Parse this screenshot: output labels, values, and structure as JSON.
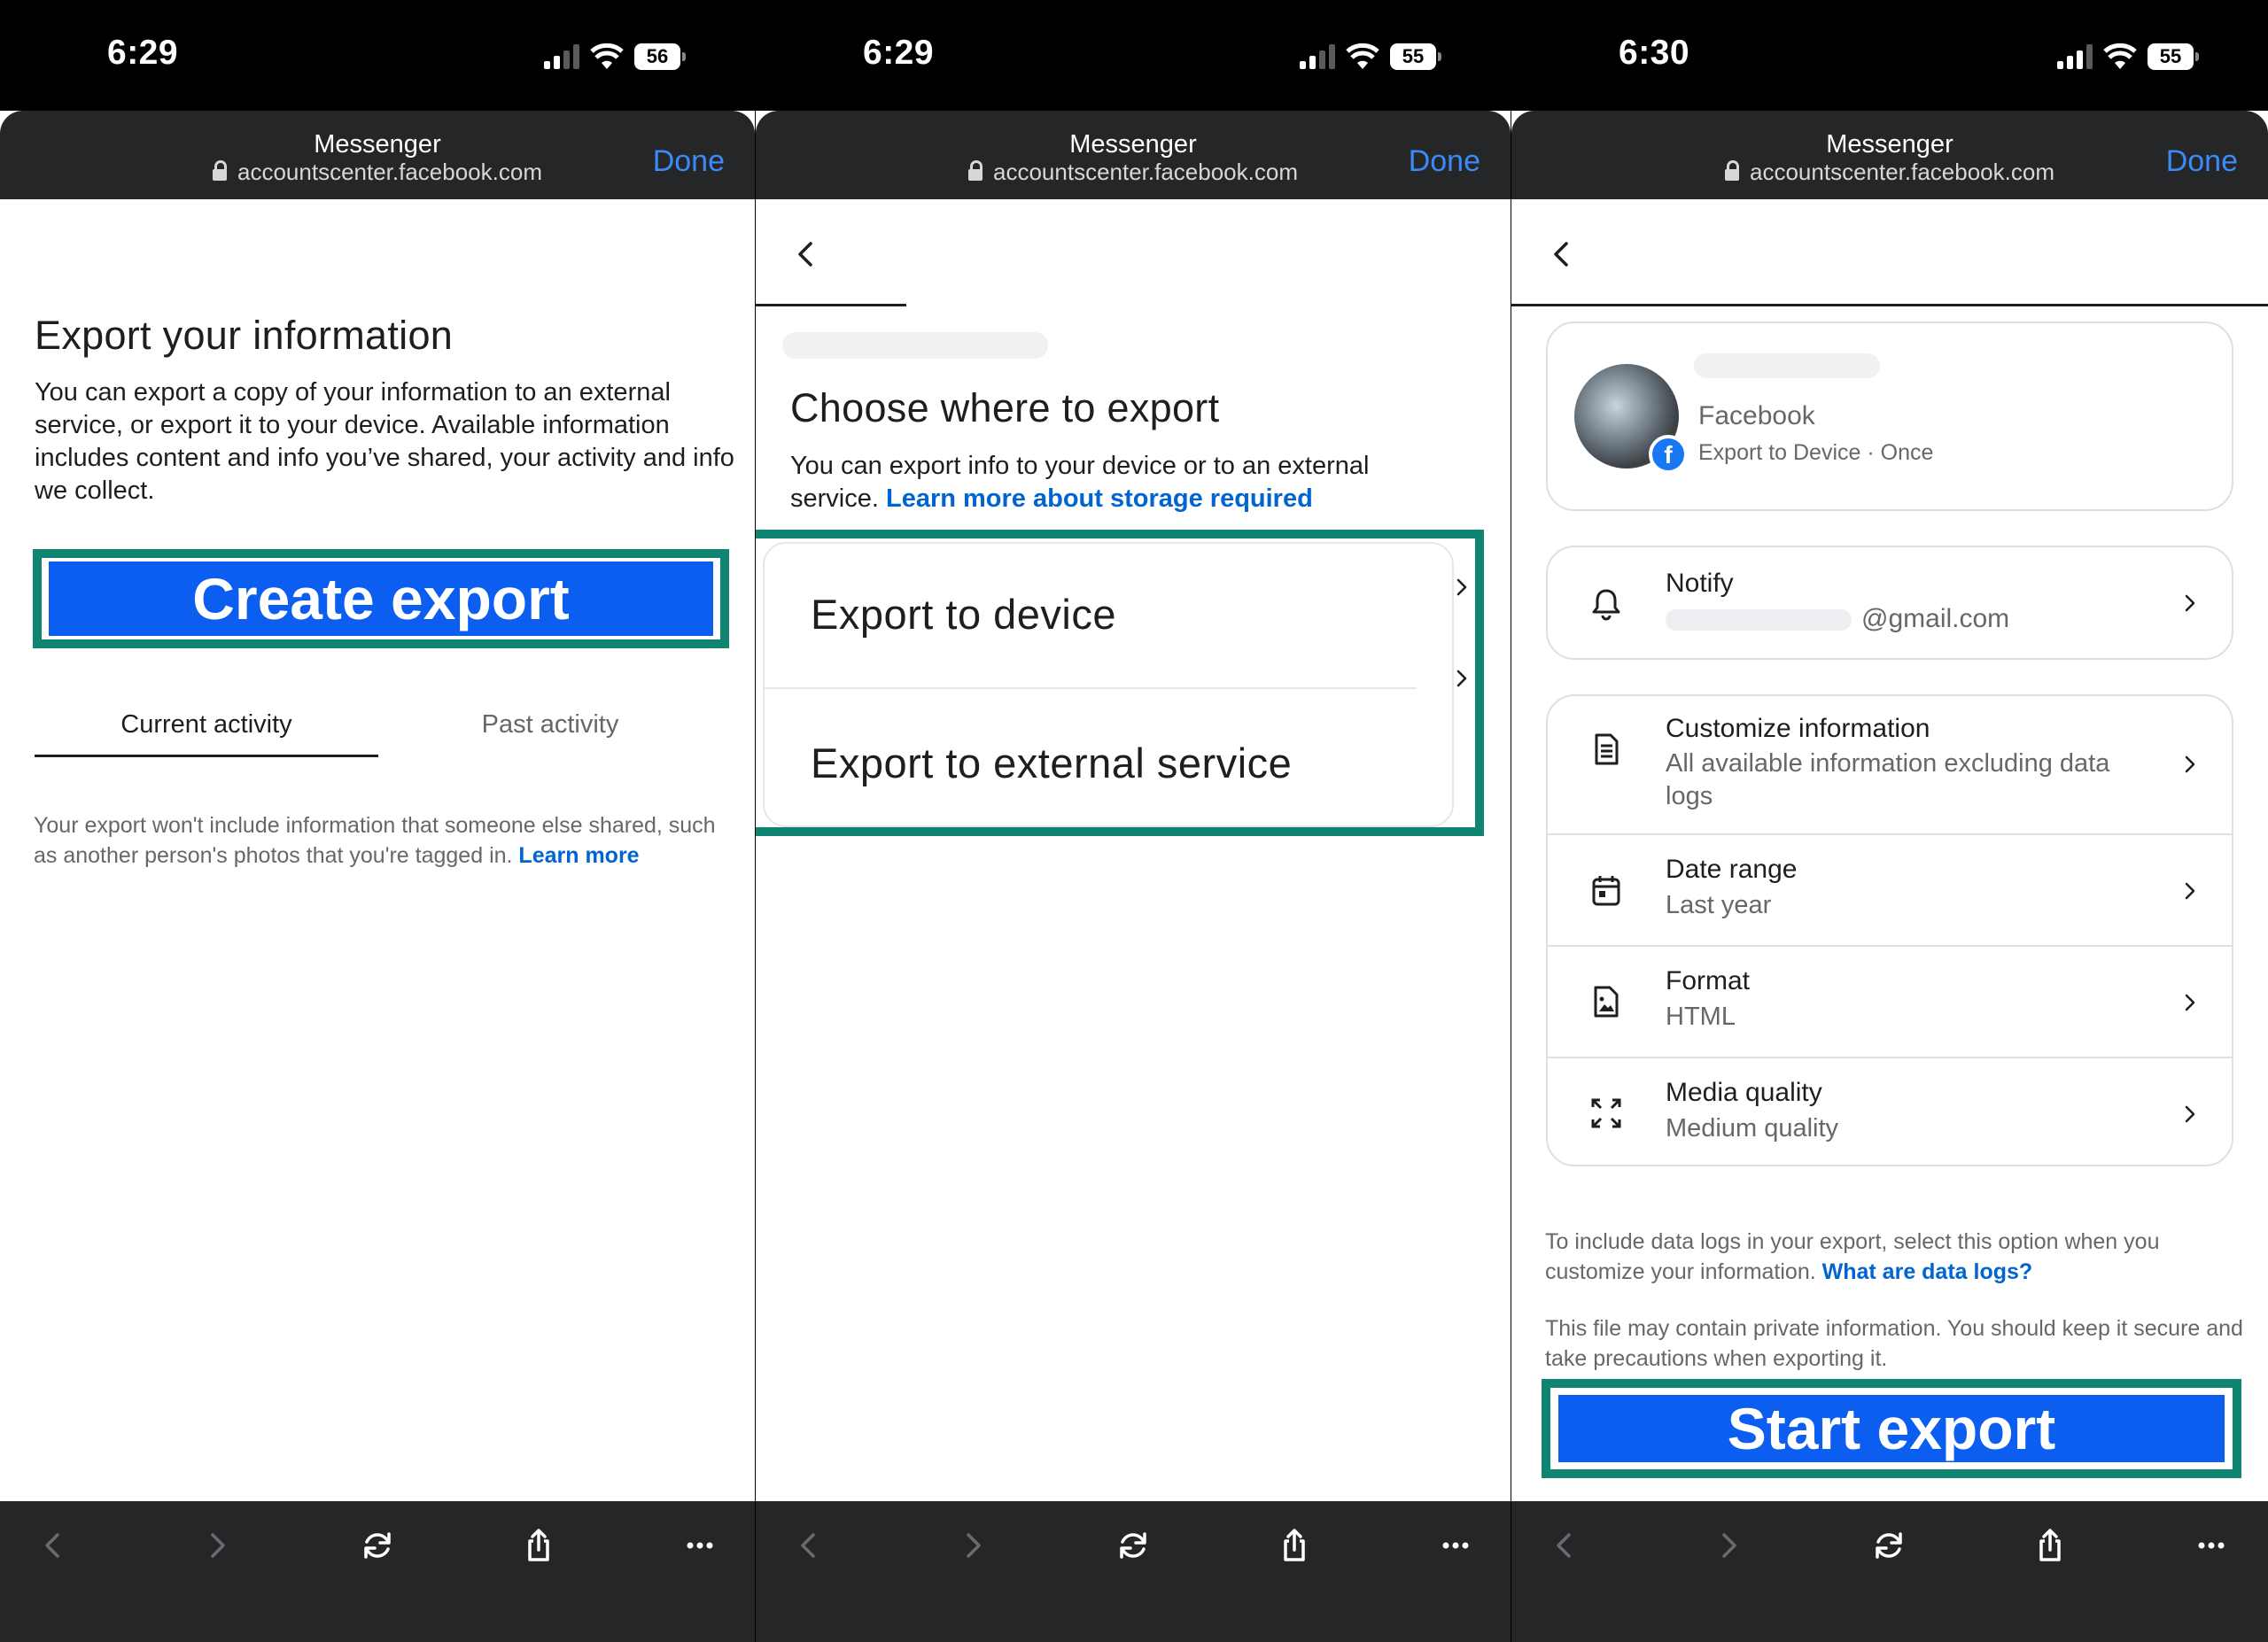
{
  "colors": {
    "highlight": "#0f8470",
    "primary_button": "#0b5ef0",
    "link": "#0064d1",
    "done": "#3b8af7"
  },
  "screens": [
    {
      "status": {
        "time": "6:29",
        "battery": "56"
      },
      "browser": {
        "title": "Messenger",
        "host": "accountscenter.facebook.com",
        "done": "Done"
      },
      "heading": "Export your information",
      "description": "You can export a copy of your information to an external service, or export it to your device. Available information includes content and info you’ve shared, your activity and info we collect.",
      "create_export": "Create export",
      "tabs": [
        "Current activity",
        "Past activity"
      ],
      "note": "Your export won't include information that someone else shared, such as another person's photos that you're tagged in.",
      "note_link": "Learn more"
    },
    {
      "status": {
        "time": "6:29",
        "battery": "55"
      },
      "browser": {
        "title": "Messenger",
        "host": "accountscenter.facebook.com",
        "done": "Done"
      },
      "heading": "Choose where to export",
      "description": "You can export info to your device or to an external service.",
      "description_link": "Learn more about storage required",
      "options": [
        "Export to device",
        "Export to external service"
      ]
    },
    {
      "status": {
        "time": "6:30",
        "battery": "55"
      },
      "browser": {
        "title": "Messenger",
        "host": "accountscenter.facebook.com",
        "done": "Done"
      },
      "profile": {
        "platform": "Facebook",
        "detail": "Export to Device · Once"
      },
      "notify": {
        "title": "Notify",
        "email_suffix": "@gmail.com",
        "icon": "bell-icon"
      },
      "settings": [
        {
          "title": "Customize information",
          "value": "All available information excluding data logs",
          "icon": "document-icon"
        },
        {
          "title": "Date range",
          "value": "Last year",
          "icon": "calendar-icon"
        },
        {
          "title": "Format",
          "value": "HTML",
          "icon": "image-file-icon"
        },
        {
          "title": "Media quality",
          "value": "Medium quality",
          "icon": "expand-icon"
        }
      ],
      "data_logs_note": "To include data logs in your export, select this option when you customize your information.",
      "data_logs_link": "What are data logs?",
      "private_note": "This file may contain private information. You should keep it secure and take precautions when exporting it.",
      "start_export": "Start export"
    }
  ]
}
